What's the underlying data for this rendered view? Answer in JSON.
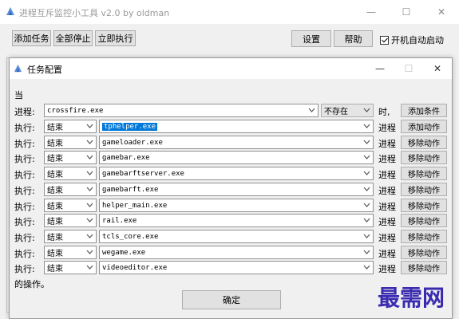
{
  "main_window": {
    "title": "进程互斥监控小工具 v2.0 by oldman",
    "buttons": {
      "add_task": "添加任务",
      "stop_all": "全部停止",
      "run_now": "立即执行",
      "settings": "设置",
      "help": "帮助"
    },
    "autostart": {
      "label": "开机自动启动",
      "checked": true
    }
  },
  "dialog": {
    "title": "任务配置",
    "when_label": "当",
    "process_label": "进程:",
    "process_value": "crossfire.exe",
    "state_value": "不存在",
    "time_suffix": "时,",
    "add_condition": "添加条件",
    "rows": [
      {
        "label": "执行:",
        "action": "结束",
        "process": "tphelper.exe",
        "suffix": "进程",
        "button": "添加动作",
        "selected": true
      },
      {
        "label": "执行:",
        "action": "结束",
        "process": "gameloader.exe",
        "suffix": "进程",
        "button": "移除动作"
      },
      {
        "label": "执行:",
        "action": "结束",
        "process": "gamebar.exe",
        "suffix": "进程",
        "button": "移除动作"
      },
      {
        "label": "执行:",
        "action": "结束",
        "process": "gamebarftserver.exe",
        "suffix": "进程",
        "button": "移除动作"
      },
      {
        "label": "执行:",
        "action": "结束",
        "process": "gamebarft.exe",
        "suffix": "进程",
        "button": "移除动作"
      },
      {
        "label": "执行:",
        "action": "结束",
        "process": "helper_main.exe",
        "suffix": "进程",
        "button": "移除动作"
      },
      {
        "label": "执行:",
        "action": "结束",
        "process": "rail.exe",
        "suffix": "进程",
        "button": "移除动作"
      },
      {
        "label": "执行:",
        "action": "结束",
        "process": "tcls_core.exe",
        "suffix": "进程",
        "button": "移除动作"
      },
      {
        "label": "执行:",
        "action": "结束",
        "process": "wegame.exe",
        "suffix": "进程",
        "button": "移除动作"
      },
      {
        "label": "执行:",
        "action": "结束",
        "process": "videoeditor.exe",
        "suffix": "进程",
        "button": "移除动作"
      }
    ],
    "footer_label": "的操作。",
    "confirm": "确定"
  },
  "watermark": "最需网",
  "colors": {
    "selection": "#0078d7",
    "watermark": "#3a2bb0"
  }
}
